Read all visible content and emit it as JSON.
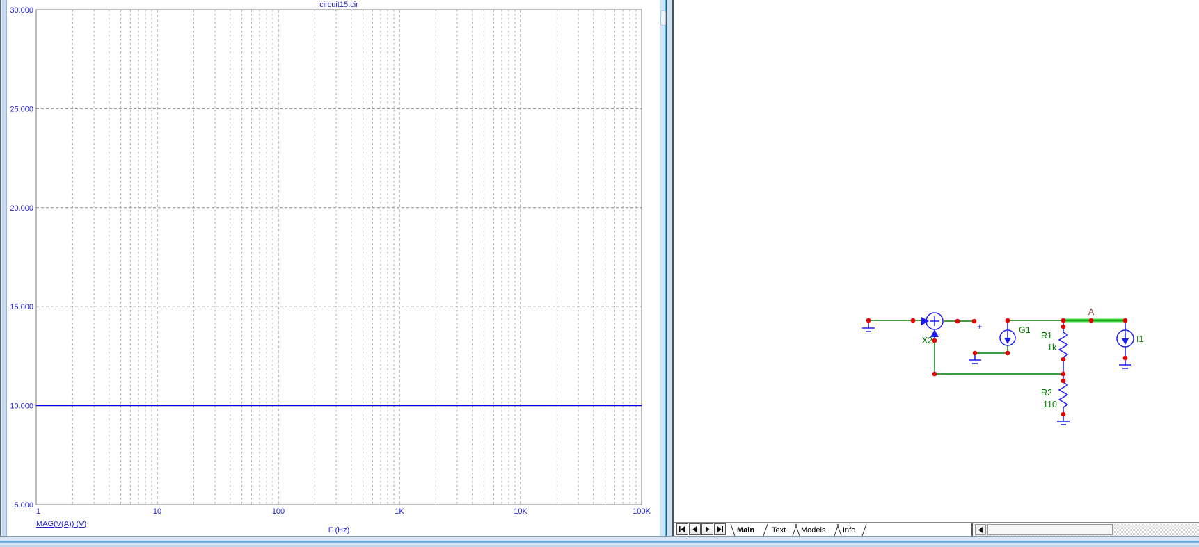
{
  "window_title": "circuit15.cir",
  "chart_data": {
    "type": "line",
    "title": "circuit15.cir",
    "xlabel": "F (Hz)",
    "ylabel": "",
    "x_scale": "log",
    "xlim": [
      1,
      100000
    ],
    "ylim": [
      5,
      30
    ],
    "y_tick_step": 5,
    "y_tick_labels": [
      "30.000",
      "25.000",
      "20.000",
      "15.000",
      "10.000",
      "5.000"
    ],
    "x_tick_labels": [
      "1",
      "10",
      "100",
      "1K",
      "10K",
      "100K"
    ],
    "grid": true,
    "legend_position": "bottom-left",
    "series": [
      {
        "name": "MAG(V(A)) (V)",
        "x": [
          1,
          100000
        ],
        "y": [
          10,
          10
        ]
      }
    ]
  },
  "schematic": {
    "node_label": "A",
    "plus_marker": "+",
    "components": [
      {
        "id": "X2",
        "type": "summing-junction"
      },
      {
        "id": "G1",
        "type": "controlled-current-source"
      },
      {
        "id": "R1",
        "value": "1k",
        "type": "resistor"
      },
      {
        "id": "R2",
        "value": "110",
        "type": "resistor"
      },
      {
        "id": "I1",
        "type": "current-source"
      }
    ]
  },
  "tab_bar": {
    "nav_buttons": [
      {
        "name": "first-page"
      },
      {
        "name": "prev-page"
      },
      {
        "name": "next-page"
      },
      {
        "name": "last-page"
      }
    ],
    "tabs": [
      {
        "label": "Main",
        "active": true
      },
      {
        "label": "Text",
        "active": false
      },
      {
        "label": "Models",
        "active": false
      },
      {
        "label": "Info",
        "active": false
      }
    ]
  },
  "colors": {
    "plot_text": "#2222d4",
    "trace": "#0000f0",
    "grid_major": "#8c8c8c",
    "grid_minor": "#a8a8a8",
    "frame": "#7a7a7a",
    "wire": "#007a00",
    "component": "#1c1cf0",
    "junction": "#e60000",
    "comp_label": "#007a00",
    "node_label": "#993333",
    "highlight": "#3ed43e"
  }
}
